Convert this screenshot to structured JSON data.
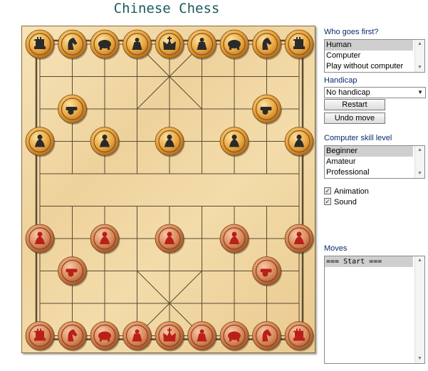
{
  "title": "Chinese Chess",
  "colors": {
    "board": "#f1d9a6",
    "line": "#5a4a32",
    "black_piece": "#e8a640",
    "red_piece": "#d98a5a",
    "label": "#0a2a6e",
    "title": "#1d5a5c"
  },
  "who_first": {
    "label": "Who goes first?",
    "options": [
      "Human",
      "Computer",
      "Play without computer"
    ],
    "selected": 0
  },
  "handicap": {
    "label": "Handicap",
    "value": "No handicap"
  },
  "buttons": {
    "restart": "Restart",
    "undo": "Undo move"
  },
  "skill": {
    "label": "Computer skill level",
    "options": [
      "Beginner",
      "Amateur",
      "Professional"
    ],
    "selected": 0
  },
  "checks": {
    "animation": "Animation",
    "sound": "Sound"
  },
  "moves": {
    "label": "Moves",
    "entries": [
      "=== Start ==="
    ]
  },
  "pieces": {
    "black": [
      {
        "type": "chariot",
        "col": 0,
        "row": 0
      },
      {
        "type": "horse",
        "col": 1,
        "row": 0
      },
      {
        "type": "elephant",
        "col": 2,
        "row": 0
      },
      {
        "type": "advisor",
        "col": 3,
        "row": 0
      },
      {
        "type": "general",
        "col": 4,
        "row": 0
      },
      {
        "type": "advisor",
        "col": 5,
        "row": 0
      },
      {
        "type": "elephant",
        "col": 6,
        "row": 0
      },
      {
        "type": "horse",
        "col": 7,
        "row": 0
      },
      {
        "type": "chariot",
        "col": 8,
        "row": 0
      },
      {
        "type": "cannon",
        "col": 1,
        "row": 2
      },
      {
        "type": "cannon",
        "col": 7,
        "row": 2
      },
      {
        "type": "soldier",
        "col": 0,
        "row": 3
      },
      {
        "type": "soldier",
        "col": 2,
        "row": 3
      },
      {
        "type": "soldier",
        "col": 4,
        "row": 3
      },
      {
        "type": "soldier",
        "col": 6,
        "row": 3
      },
      {
        "type": "soldier",
        "col": 8,
        "row": 3
      }
    ],
    "red": [
      {
        "type": "soldier",
        "col": 0,
        "row": 6
      },
      {
        "type": "soldier",
        "col": 2,
        "row": 6
      },
      {
        "type": "soldier",
        "col": 4,
        "row": 6
      },
      {
        "type": "soldier",
        "col": 6,
        "row": 6
      },
      {
        "type": "soldier",
        "col": 8,
        "row": 6
      },
      {
        "type": "cannon",
        "col": 1,
        "row": 7
      },
      {
        "type": "cannon",
        "col": 7,
        "row": 7
      },
      {
        "type": "chariot",
        "col": 0,
        "row": 9
      },
      {
        "type": "horse",
        "col": 1,
        "row": 9
      },
      {
        "type": "elephant",
        "col": 2,
        "row": 9
      },
      {
        "type": "advisor",
        "col": 3,
        "row": 9
      },
      {
        "type": "general",
        "col": 4,
        "row": 9
      },
      {
        "type": "advisor",
        "col": 5,
        "row": 9
      },
      {
        "type": "elephant",
        "col": 6,
        "row": 9
      },
      {
        "type": "horse",
        "col": 7,
        "row": 9
      },
      {
        "type": "chariot",
        "col": 8,
        "row": 9
      }
    ]
  }
}
